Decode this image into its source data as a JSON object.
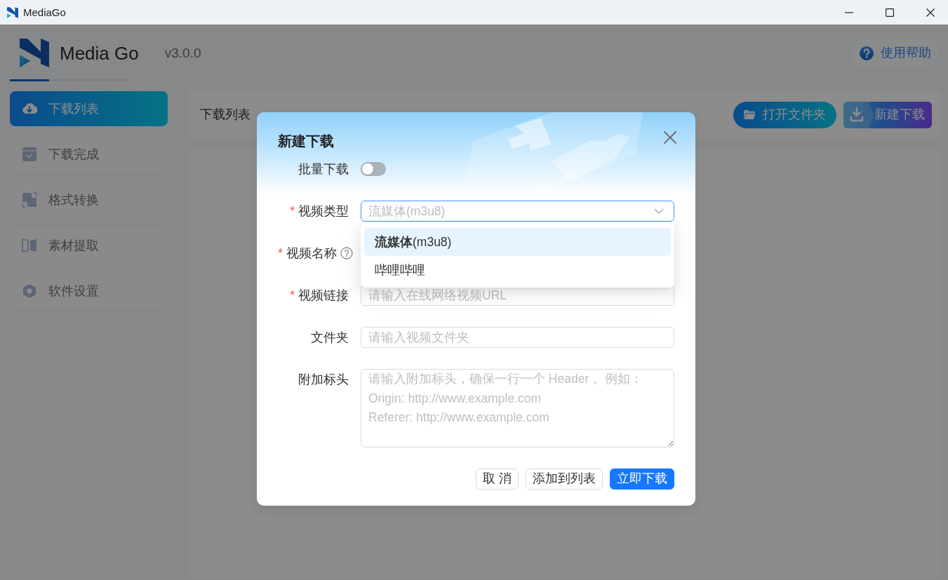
{
  "window": {
    "title": "MediaGo"
  },
  "header": {
    "app_name": "Media Go",
    "version": "v3.0.0",
    "help_button": "使用帮助"
  },
  "sidebar": {
    "items": [
      {
        "label": "下载列表",
        "selected": true
      },
      {
        "label": "下载完成",
        "selected": false
      },
      {
        "label": "格式转换",
        "selected": false
      },
      {
        "label": "素材提取",
        "selected": false
      },
      {
        "label": "软件设置",
        "selected": false
      }
    ]
  },
  "toolbar": {
    "title": "下载列表",
    "buttons": [
      {
        "label": "打开文件夹",
        "kind": "pill"
      },
      {
        "label": "新建下载",
        "kind": "split"
      }
    ]
  },
  "dialog": {
    "title": "新建下载",
    "fields": [
      {
        "kind": "switch",
        "label": "批量下载",
        "on": false
      },
      {
        "kind": "select",
        "label": "视频类型",
        "required_mark": "*",
        "value": "流媒体(m3u8)",
        "open": true,
        "options": [
          {
            "label": "**流媒体**(m3u8)",
            "selected": true
          },
          {
            "label": "哔哩哔哩",
            "selected": false
          }
        ]
      },
      {
        "kind": "covered",
        "label": "视频名称",
        "required_mark": "*",
        "hint": true
      },
      {
        "kind": "text",
        "label": "视频链接",
        "required_mark": "*",
        "placeholder": "请输入在线网络视频URL"
      },
      {
        "kind": "text",
        "label": "文件夹",
        "placeholder": "请输入视频文件夹"
      },
      {
        "kind": "textarea",
        "label": "附加标头",
        "placeholder": "请输入附加标头，确保一行一个 Header， 例如：\nOrigin: http://www.example.com\nReferer: http://www.example.com"
      }
    ],
    "buttons": [
      {
        "label": "取 消",
        "kind": "default"
      },
      {
        "label": "添加到列表",
        "kind": "default"
      },
      {
        "label": "立即下载",
        "kind": "primary"
      }
    ]
  }
}
